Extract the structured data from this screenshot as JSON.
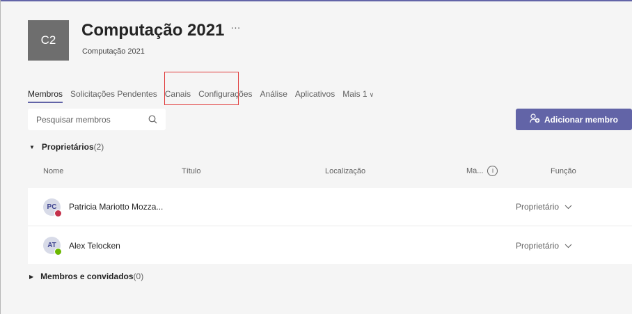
{
  "team": {
    "initials": "C2",
    "name": "Computação 2021",
    "more_glyph": "···",
    "subtitle": "Computação 2021",
    "avatar_color": "#6e6e6e"
  },
  "tabs": [
    {
      "label": "Membros",
      "active": true
    },
    {
      "label": "Solicitações Pendentes"
    },
    {
      "label": "Canais"
    },
    {
      "label": "Configurações"
    },
    {
      "label": "Análise"
    },
    {
      "label": "Aplicativos"
    },
    {
      "label": "Mais 1",
      "chevron": "∨"
    }
  ],
  "search": {
    "placeholder": "Pesquisar membros",
    "icon": "search-icon"
  },
  "add_member": {
    "label": "Adicionar membro",
    "icon": "add-person-icon",
    "color": "#6264a7"
  },
  "owners_section": {
    "label": "Proprietários",
    "count": "(2)",
    "expanded": true
  },
  "columns": {
    "name": "Nome",
    "title": "Título",
    "location": "Localização",
    "ma": "Ma...",
    "info": "i",
    "role": "Função"
  },
  "owners": [
    {
      "initials": "PC",
      "name": "Patricia Mariotto Mozza...",
      "role": "Proprietário",
      "presence": "busy",
      "presence_color": "#c4314b"
    },
    {
      "initials": "AT",
      "name": "Alex Telocken",
      "role": "Proprietário",
      "presence": "available",
      "presence_color": "#6bb700"
    }
  ],
  "members_section": {
    "label": "Membros e convidados",
    "count": "(0)",
    "expanded": false
  },
  "accent_color": "#6264a7",
  "highlight_color": "#e03a3a"
}
